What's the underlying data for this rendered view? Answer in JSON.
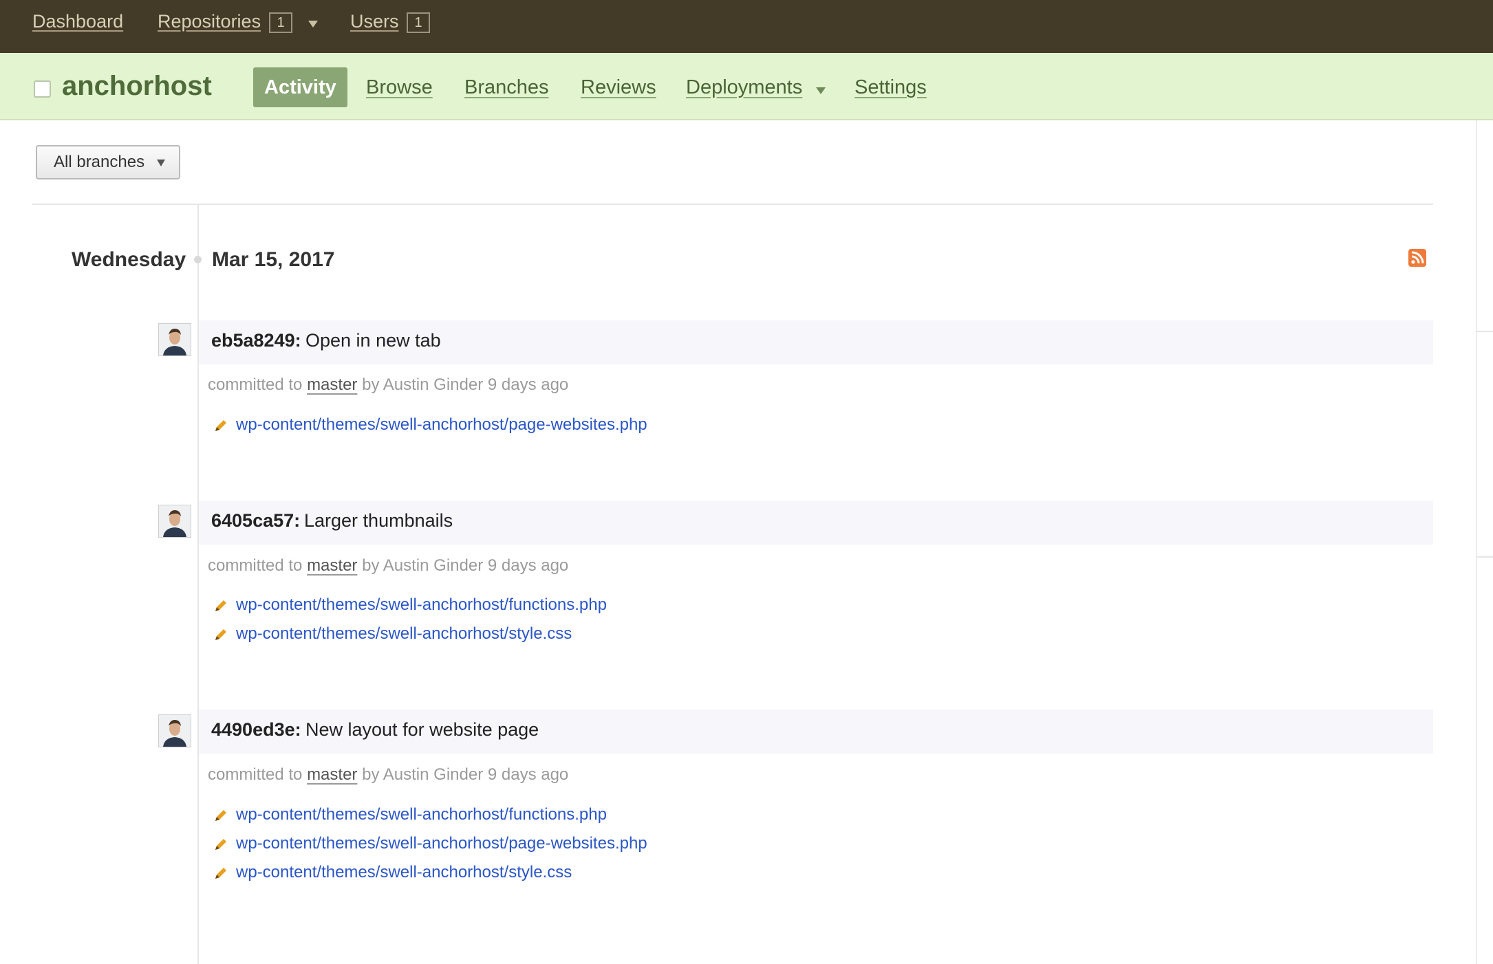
{
  "topnav": {
    "dashboard": "Dashboard",
    "repositories": "Repositories",
    "repositories_count": "1",
    "users": "Users",
    "users_count": "1"
  },
  "repo": {
    "name": "anchorhost",
    "tabs": [
      {
        "label": "Activity",
        "active": true
      },
      {
        "label": "Browse",
        "active": false
      },
      {
        "label": "Branches",
        "active": false
      },
      {
        "label": "Reviews",
        "active": false
      },
      {
        "label": "Deployments",
        "active": false
      },
      {
        "label": "Settings",
        "active": false
      }
    ]
  },
  "filter": {
    "branch_select": "All branches"
  },
  "activity": {
    "day_name": "Wednesday",
    "date": "Mar 15, 2017",
    "commits": [
      {
        "id": "eb5a8249:",
        "message": "Open in new tab",
        "meta_prefix": "committed to",
        "branch": "master",
        "meta_suffix": "by Austin Ginder 9 days ago",
        "files": [
          "wp-content/themes/swell-anchorhost/page-websites.php"
        ]
      },
      {
        "id": "6405ca57:",
        "message": "Larger thumbnails",
        "meta_prefix": "committed to",
        "branch": "master",
        "meta_suffix": "by Austin Ginder 9 days ago",
        "files": [
          "wp-content/themes/swell-anchorhost/functions.php",
          "wp-content/themes/swell-anchorhost/style.css"
        ]
      },
      {
        "id": "4490ed3e:",
        "message": "New layout for website page",
        "meta_prefix": "committed to",
        "branch": "master",
        "meta_suffix": "by Austin Ginder 9 days ago",
        "files": [
          "wp-content/themes/swell-anchorhost/functions.php",
          "wp-content/themes/swell-anchorhost/page-websites.php",
          "wp-content/themes/swell-anchorhost/style.css"
        ]
      }
    ]
  },
  "colors": {
    "topbar_bg": "#433a28",
    "repobar_bg": "#e3f4d0",
    "active_tab": "#8aa674",
    "link_blue": "#2a56c6",
    "pencil_orange": "#e8a020",
    "rss_orange": "#ef7b3a"
  }
}
